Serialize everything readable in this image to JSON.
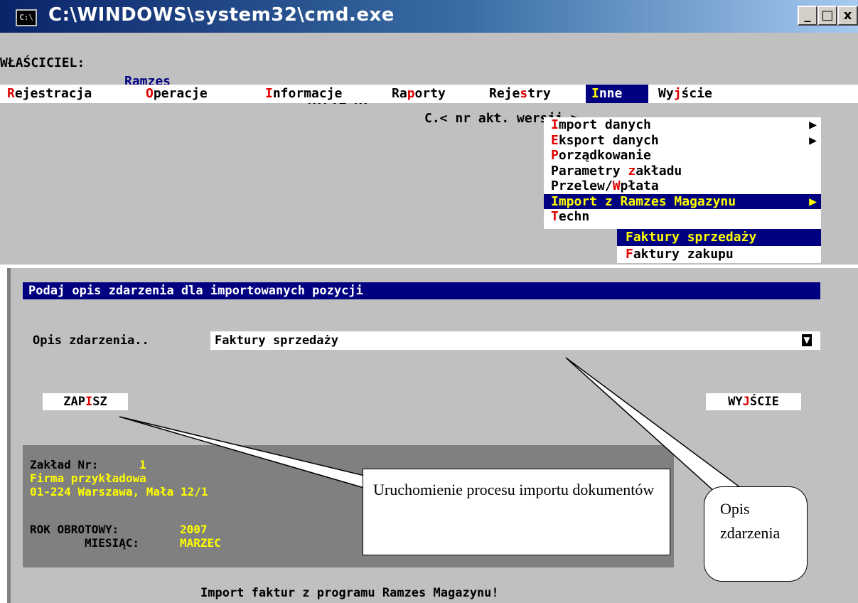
{
  "window": {
    "title": "C:\\WINDOWS\\system32\\cmd.exe",
    "icon": "C:\\",
    "controls": {
      "minimize": "_",
      "maximize": "□",
      "close": "x"
    }
  },
  "status": {
    "owner_label": "WŁAŚCICIEL:",
    "owner_name": "Ramzes",
    "company": "K.P.i R.",
    "version": "C.< nr akt. wersji >"
  },
  "menu": [
    {
      "pre": "",
      "hot": "R",
      "post": "ejestracja"
    },
    {
      "pre": "",
      "hot": "O",
      "post": "peracje"
    },
    {
      "pre": "",
      "hot": "I",
      "post": "nformacje"
    },
    {
      "pre": "Ra",
      "hot": "p",
      "post": "orty"
    },
    {
      "pre": "Reje",
      "hot": "s",
      "post": "try"
    },
    {
      "pre": "",
      "hot": "I",
      "post": "nne"
    },
    {
      "pre": "Wy",
      "hot": "j",
      "post": "ście"
    }
  ],
  "dropdown": [
    {
      "pre": "",
      "hot": "I",
      "post": "mport danych",
      "arrow": "▶"
    },
    {
      "pre": "",
      "hot": "E",
      "post": "ksport danych",
      "arrow": "▶"
    },
    {
      "pre": "",
      "hot": "P",
      "post": "orządkowanie",
      "arrow": ""
    },
    {
      "pre": "Parametry ",
      "hot": "z",
      "post": "akładu",
      "arrow": ""
    },
    {
      "pre": "Przelew/",
      "hot": "W",
      "post": "płata",
      "arrow": ""
    },
    {
      "pre": "Import z Ramzes Magazynu",
      "hot": "",
      "post": "",
      "arrow": "▶"
    },
    {
      "pre": "",
      "hot": "T",
      "post": "echn",
      "arrow": ""
    }
  ],
  "submenu": [
    {
      "pre": "Faktury sprzedaży",
      "hot": "",
      "post": ""
    },
    {
      "pre": "",
      "hot": "F",
      "post": "aktury zakupu"
    }
  ],
  "dialog": {
    "prompt": "Podaj opis zdarzenia dla importowanych pozycji",
    "field_label": "Opis zdarzenia..",
    "field_value": "Faktury sprzedaży",
    "field_drop": "▼",
    "save": {
      "pre": "ZAP",
      "hot": "I",
      "post": "SZ"
    },
    "exit": {
      "pre": "WY",
      "hot": "J",
      "post": "ŚCIE"
    }
  },
  "info": {
    "plant_label": "Zakład Nr:",
    "plant_no": "1",
    "firm_name": "Firma przykładowa",
    "firm_address": "01-224 Warszawa, Mała 12/1",
    "year_label": "ROK OBROTOWY:",
    "year": "2007",
    "month_label": "MIESIĄC:",
    "month": "MARZEC"
  },
  "footer": "Import faktur z programu Ramzes Magazynu!",
  "callouts": {
    "import": "Uruchomienie procesu importu dokumentów",
    "desc": "Opis zdarzenia"
  }
}
